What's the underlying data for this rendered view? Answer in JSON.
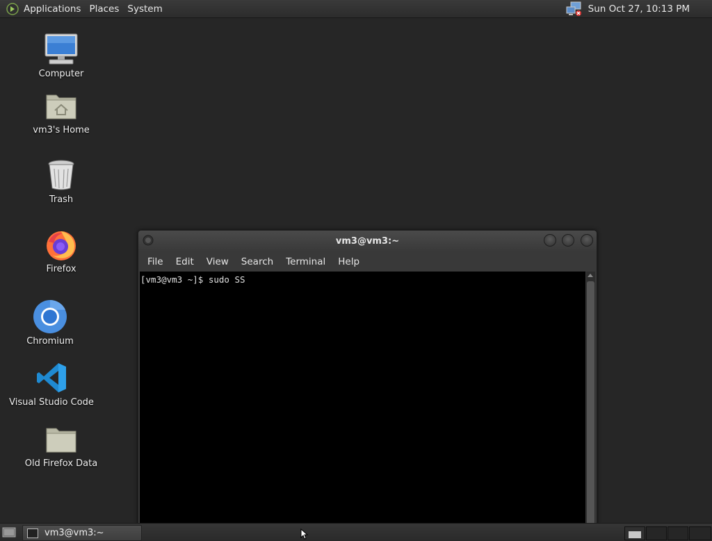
{
  "top_panel": {
    "menus": [
      "Applications",
      "Places",
      "System"
    ],
    "clock": "Sun Oct 27, 10:13 PM"
  },
  "desktop": {
    "icons": [
      {
        "label": "Computer",
        "icon": "computer-icon"
      },
      {
        "label": "vm3's Home",
        "icon": "home-folder-icon"
      },
      {
        "label": "Trash",
        "icon": "trash-icon"
      },
      {
        "label": "Firefox",
        "icon": "firefox-icon"
      },
      {
        "label": "Chromium",
        "icon": "chromium-icon"
      },
      {
        "label": "Visual Studio Code",
        "icon": "vscode-icon"
      },
      {
        "label": "Old Firefox Data",
        "icon": "folder-icon"
      }
    ]
  },
  "terminal": {
    "title": "vm3@vm3:~",
    "menu": [
      "File",
      "Edit",
      "View",
      "Search",
      "Terminal",
      "Help"
    ],
    "prompt_line": "[vm3@vm3 ~]$ sudo SS"
  },
  "bottom_panel": {
    "task_label": "vm3@vm3:~"
  },
  "colors": {
    "desktop_bg": "#262626",
    "panel_bg": "#2c2c2c",
    "terminal_bg": "#000000"
  }
}
